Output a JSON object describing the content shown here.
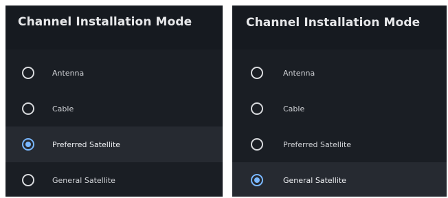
{
  "screens": [
    {
      "title": "Channel Installation Mode",
      "selected_index": 2,
      "options": [
        {
          "label": "Antenna"
        },
        {
          "label": "Cable"
        },
        {
          "label": "Preferred Satellite"
        },
        {
          "label": "General Satellite"
        }
      ]
    },
    {
      "title": "Channel Installation Mode",
      "selected_index": 3,
      "options": [
        {
          "label": "Antenna"
        },
        {
          "label": "Cable"
        },
        {
          "label": "Preferred Satellite"
        },
        {
          "label": "General Satellite"
        }
      ]
    }
  ],
  "colors": {
    "panel_background": "#161a20",
    "selected_row": "#262a31",
    "accent": "#79b7ff",
    "text": "#e7e8ea"
  },
  "icons": {
    "unselected": "radio-unchecked-icon",
    "selected": "radio-checked-icon"
  }
}
